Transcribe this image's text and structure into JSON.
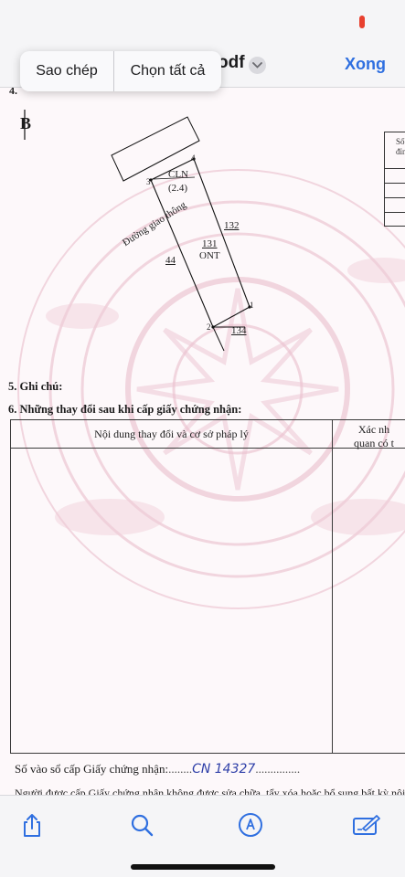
{
  "navbar": {
    "file_name_suffix": "odf",
    "done_label": "Xong",
    "context_menu": {
      "copy_label": "Sao chép",
      "select_all_label": "Chọn tất cả"
    }
  },
  "document": {
    "cut_heading": "4.",
    "north_symbol": "B",
    "map": {
      "road_label": "Đường giao thông",
      "point_1": "1",
      "point_2": "2",
      "point_3": "3",
      "point_4": "4",
      "land_type_top": "CLN",
      "land_area_top": "(2.4)",
      "parcel_number": "131",
      "parcel_type": "ONT",
      "neighbor_132": "132",
      "neighbor_44": "44",
      "neighbor_134": "134"
    },
    "right_table_header": "Số\nđỉn",
    "section_5": "5. Ghi chú:",
    "section_6": "6. Những thay đổi sau khi cấp giấy chứng nhận:",
    "changes_table": {
      "col_content": "Nội dung thay đổi và cơ sở pháp lý",
      "col_confirm_1": "Xác nh",
      "col_confirm_2": "quan có t"
    },
    "register_label": "Số vào sổ cấp Giấy chứng nhận:",
    "register_dots_before": "........",
    "register_number": "CN 14327",
    "register_dots_after": "...............",
    "footnote": "Người được cấp Giấy chứng nhận không được sửa chữa, tẩy xóa hoặc bổ sung bất kỳ nội"
  },
  "toolbar": {
    "share": "share-icon",
    "search": "search-icon",
    "markup": "markup-icon",
    "edit": "edit-icon"
  },
  "colors": {
    "accent": "#2f6fe0",
    "watermark": "#e9b9c8",
    "handwriting": "#2e3fa8"
  }
}
